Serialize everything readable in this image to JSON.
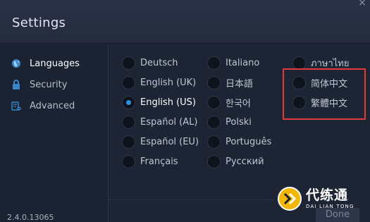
{
  "window": {
    "title": "Settings",
    "close_glyph": "×"
  },
  "sidebar": {
    "items": [
      {
        "label": "Languages",
        "icon": "globe-icon",
        "active": true
      },
      {
        "label": "Security",
        "icon": "lock-icon",
        "active": false
      },
      {
        "label": "Advanced",
        "icon": "advanced-settings-icon",
        "active": false
      }
    ],
    "version": "2.4.0.13065"
  },
  "languages": {
    "selected": "English (US)",
    "options": [
      "Deutsch",
      "English (UK)",
      "English (US)",
      "Español (AL)",
      "Español (EU)",
      "Français",
      "Italiano",
      "日本語",
      "한국어",
      "Polski",
      "Português",
      "Русский",
      "ภาษาไทย",
      "简体中文",
      "繁體中文"
    ]
  },
  "footer": {
    "done_label": "Done"
  },
  "watermark": {
    "cn": "代练通",
    "en": "DAI LIAN TONG"
  },
  "colors": {
    "accent": "#2e8fe0",
    "highlight": "#e03a3a",
    "background": "#1b2232"
  }
}
